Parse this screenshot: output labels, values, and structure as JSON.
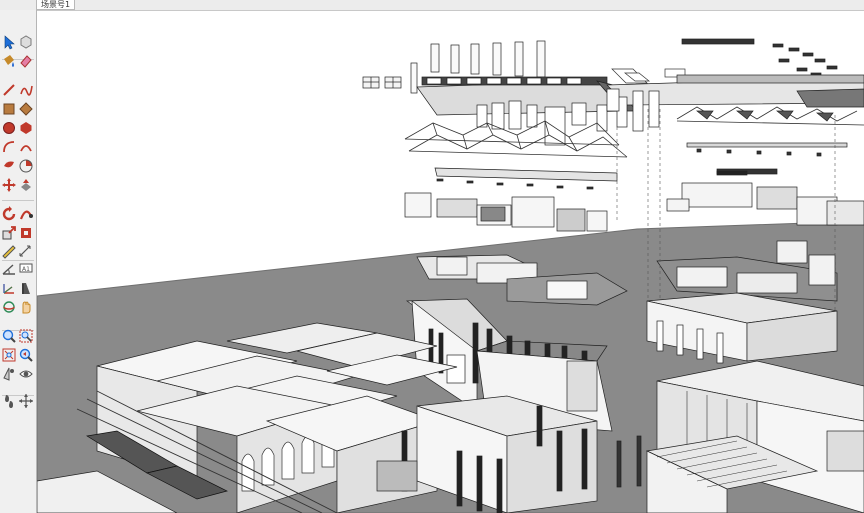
{
  "scene_tab": {
    "label": "场景号1"
  },
  "toolbar": {
    "tools": [
      {
        "name": "select-tool-icon",
        "color": "#1e6fd9"
      },
      {
        "name": "component-tool-icon",
        "color": "#7a7a7a"
      },
      {
        "name": "paint-bucket-icon",
        "color": "#c68a2a"
      },
      {
        "name": "eraser-icon",
        "color": "#e57ea5"
      },
      {
        "name": "line-tool-icon",
        "color": "#c0392b"
      },
      {
        "name": "freehand-tool-icon",
        "color": "#c0392b"
      },
      {
        "name": "rectangle-tool-icon",
        "color": "#b87b3f"
      },
      {
        "name": "rotated-rectangle-icon",
        "color": "#b87b3f"
      },
      {
        "name": "circle-tool-icon",
        "color": "#c0392b"
      },
      {
        "name": "polygon-tool-icon",
        "color": "#c0392b"
      },
      {
        "name": "arc-tool-icon",
        "color": "#c0392b"
      },
      {
        "name": "two-point-arc-icon",
        "color": "#c0392b"
      },
      {
        "name": "three-point-arc-icon",
        "color": "#c0392b"
      },
      {
        "name": "pie-tool-icon",
        "color": "#c0392b"
      },
      {
        "name": "move-tool-icon",
        "color": "#c0392b"
      },
      {
        "name": "push-pull-icon",
        "color": "#c0392b"
      },
      {
        "name": "rotate-tool-icon",
        "color": "#c0392b"
      },
      {
        "name": "follow-me-icon",
        "color": "#c0392b"
      },
      {
        "name": "scale-tool-icon",
        "color": "#c0392b"
      },
      {
        "name": "offset-tool-icon",
        "color": "#c0392b"
      },
      {
        "name": "tape-measure-icon",
        "color": "#555555"
      },
      {
        "name": "dimension-tool-icon",
        "color": "#555555"
      },
      {
        "name": "protractor-icon",
        "color": "#555555"
      },
      {
        "name": "text-tool-icon",
        "color": "#555555"
      },
      {
        "name": "axes-tool-icon",
        "color": "#555555"
      },
      {
        "name": "3d-text-icon",
        "color": "#555555"
      },
      {
        "name": "orbit-tool-icon",
        "color": "#2e8b57"
      },
      {
        "name": "pan-tool-icon",
        "color": "#c68a2a"
      },
      {
        "name": "zoom-tool-icon",
        "color": "#1e6fd9"
      },
      {
        "name": "zoom-window-icon",
        "color": "#c0392b"
      },
      {
        "name": "zoom-extents-icon",
        "color": "#c0392b"
      },
      {
        "name": "previous-view-icon",
        "color": "#1e6fd9"
      },
      {
        "name": "position-camera-icon",
        "color": "#555555"
      },
      {
        "name": "look-around-icon",
        "color": "#555555"
      },
      {
        "name": "walk-tool-icon",
        "color": "#555555"
      },
      {
        "name": "section-plane-icon",
        "color": "#555555"
      }
    ]
  }
}
